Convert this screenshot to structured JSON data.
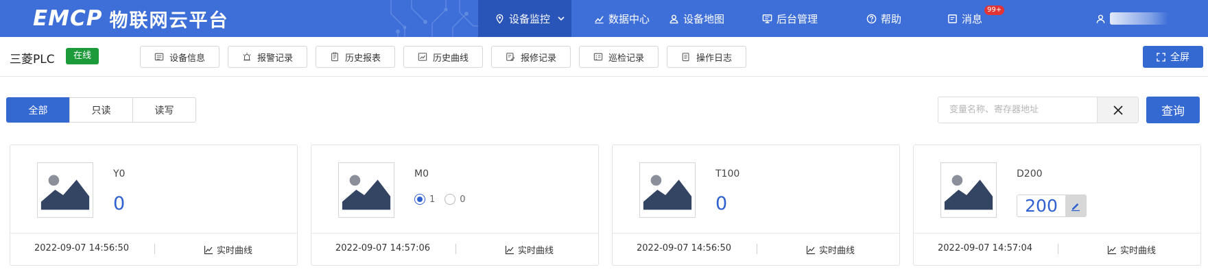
{
  "header": {
    "logo_mark": "EMCP",
    "logo_text": "物联网云平台",
    "nav": [
      {
        "label": "设备监控",
        "icon": "location-icon",
        "active": true
      },
      {
        "label": "数据中心",
        "icon": "chart-icon"
      },
      {
        "label": "设备地图",
        "icon": "user-map-icon"
      },
      {
        "label": "后台管理",
        "icon": "monitor-icon"
      },
      {
        "label": "帮助",
        "icon": "help-icon"
      },
      {
        "label": "消息",
        "icon": "message-icon",
        "badge": "99+"
      }
    ]
  },
  "device": {
    "name": "三菱PLC",
    "status": "在线",
    "tabs": [
      {
        "label": "设备信息",
        "icon": "info-card-icon"
      },
      {
        "label": "报警记录",
        "icon": "alarm-icon"
      },
      {
        "label": "历史报表",
        "icon": "report-icon"
      },
      {
        "label": "历史曲线",
        "icon": "curve-icon"
      },
      {
        "label": "报修记录",
        "icon": "repair-icon"
      },
      {
        "label": "巡检记录",
        "icon": "inspection-icon"
      },
      {
        "label": "操作日志",
        "icon": "log-icon"
      }
    ],
    "fullscreen_label": "全屏"
  },
  "filter": {
    "segments": [
      {
        "label": "全部",
        "active": true
      },
      {
        "label": "只读"
      },
      {
        "label": "读写"
      }
    ],
    "search_placeholder": "变量名称、寄存器地址",
    "search_value": "",
    "query_label": "查询"
  },
  "cards": [
    {
      "name": "Y0",
      "kind": "value",
      "value": "0",
      "time": "2022-09-07 14:56:50",
      "link": "实时曲线"
    },
    {
      "name": "M0",
      "kind": "radio",
      "options": [
        "1",
        "0"
      ],
      "selected": "1",
      "time": "2022-09-07 14:57:06",
      "link": "实时曲线"
    },
    {
      "name": "T100",
      "kind": "value",
      "value": "0",
      "time": "2022-09-07 14:56:50",
      "link": "实时曲线"
    },
    {
      "name": "D200",
      "kind": "edit",
      "value": "200",
      "time": "2022-09-07 14:57:04",
      "link": "实时曲线"
    }
  ],
  "colors": {
    "nav_bg": "#3e6fd8",
    "primary": "#3569d2",
    "online": "#1d9a3a",
    "value": "#2e61cf",
    "badge": "#e23434"
  }
}
